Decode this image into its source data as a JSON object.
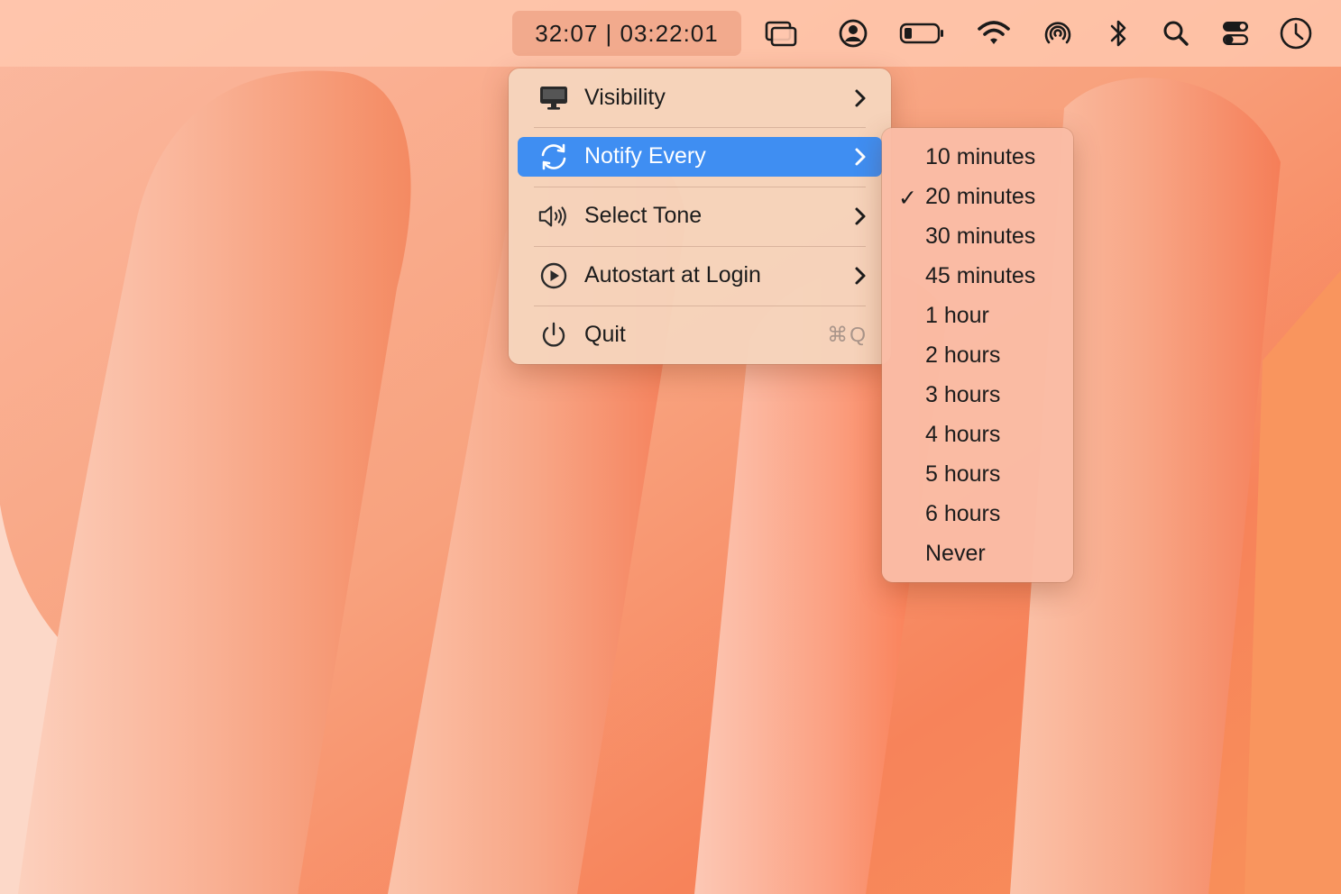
{
  "menubar": {
    "timer_text": "32:07 | 03:22:01",
    "icons": [
      "windows-icon",
      "user-circle-icon",
      "battery-icon",
      "wifi-icon",
      "airdrop-icon",
      "bluetooth-icon",
      "search-icon",
      "control-center-icon",
      "clock-icon"
    ]
  },
  "main_menu": {
    "items": [
      {
        "label": "Visibility",
        "icon": "monitor-icon",
        "has_submenu": true
      },
      {
        "label": "Notify Every",
        "icon": "sync-icon",
        "has_submenu": true,
        "highlighted": true
      },
      {
        "label": "Select Tone",
        "icon": "speaker-icon",
        "has_submenu": true
      },
      {
        "label": "Autostart at Login",
        "icon": "play-circle-icon",
        "has_submenu": true
      },
      {
        "label": "Quit",
        "icon": "power-icon",
        "shortcut": "⌘Q"
      }
    ]
  },
  "notify_submenu": {
    "selected": "20 minutes",
    "check_glyph": "✓",
    "options": [
      "10 minutes",
      "20 minutes",
      "30 minutes",
      "45 minutes",
      "1 hour",
      "2 hours",
      "3 hours",
      "4 hours",
      "5 hours",
      "6 hours",
      "Never"
    ]
  },
  "colors": {
    "highlight": "#3f8ef2",
    "menu_background": "#f6d4bc",
    "submenu_background": "#fabca5"
  }
}
